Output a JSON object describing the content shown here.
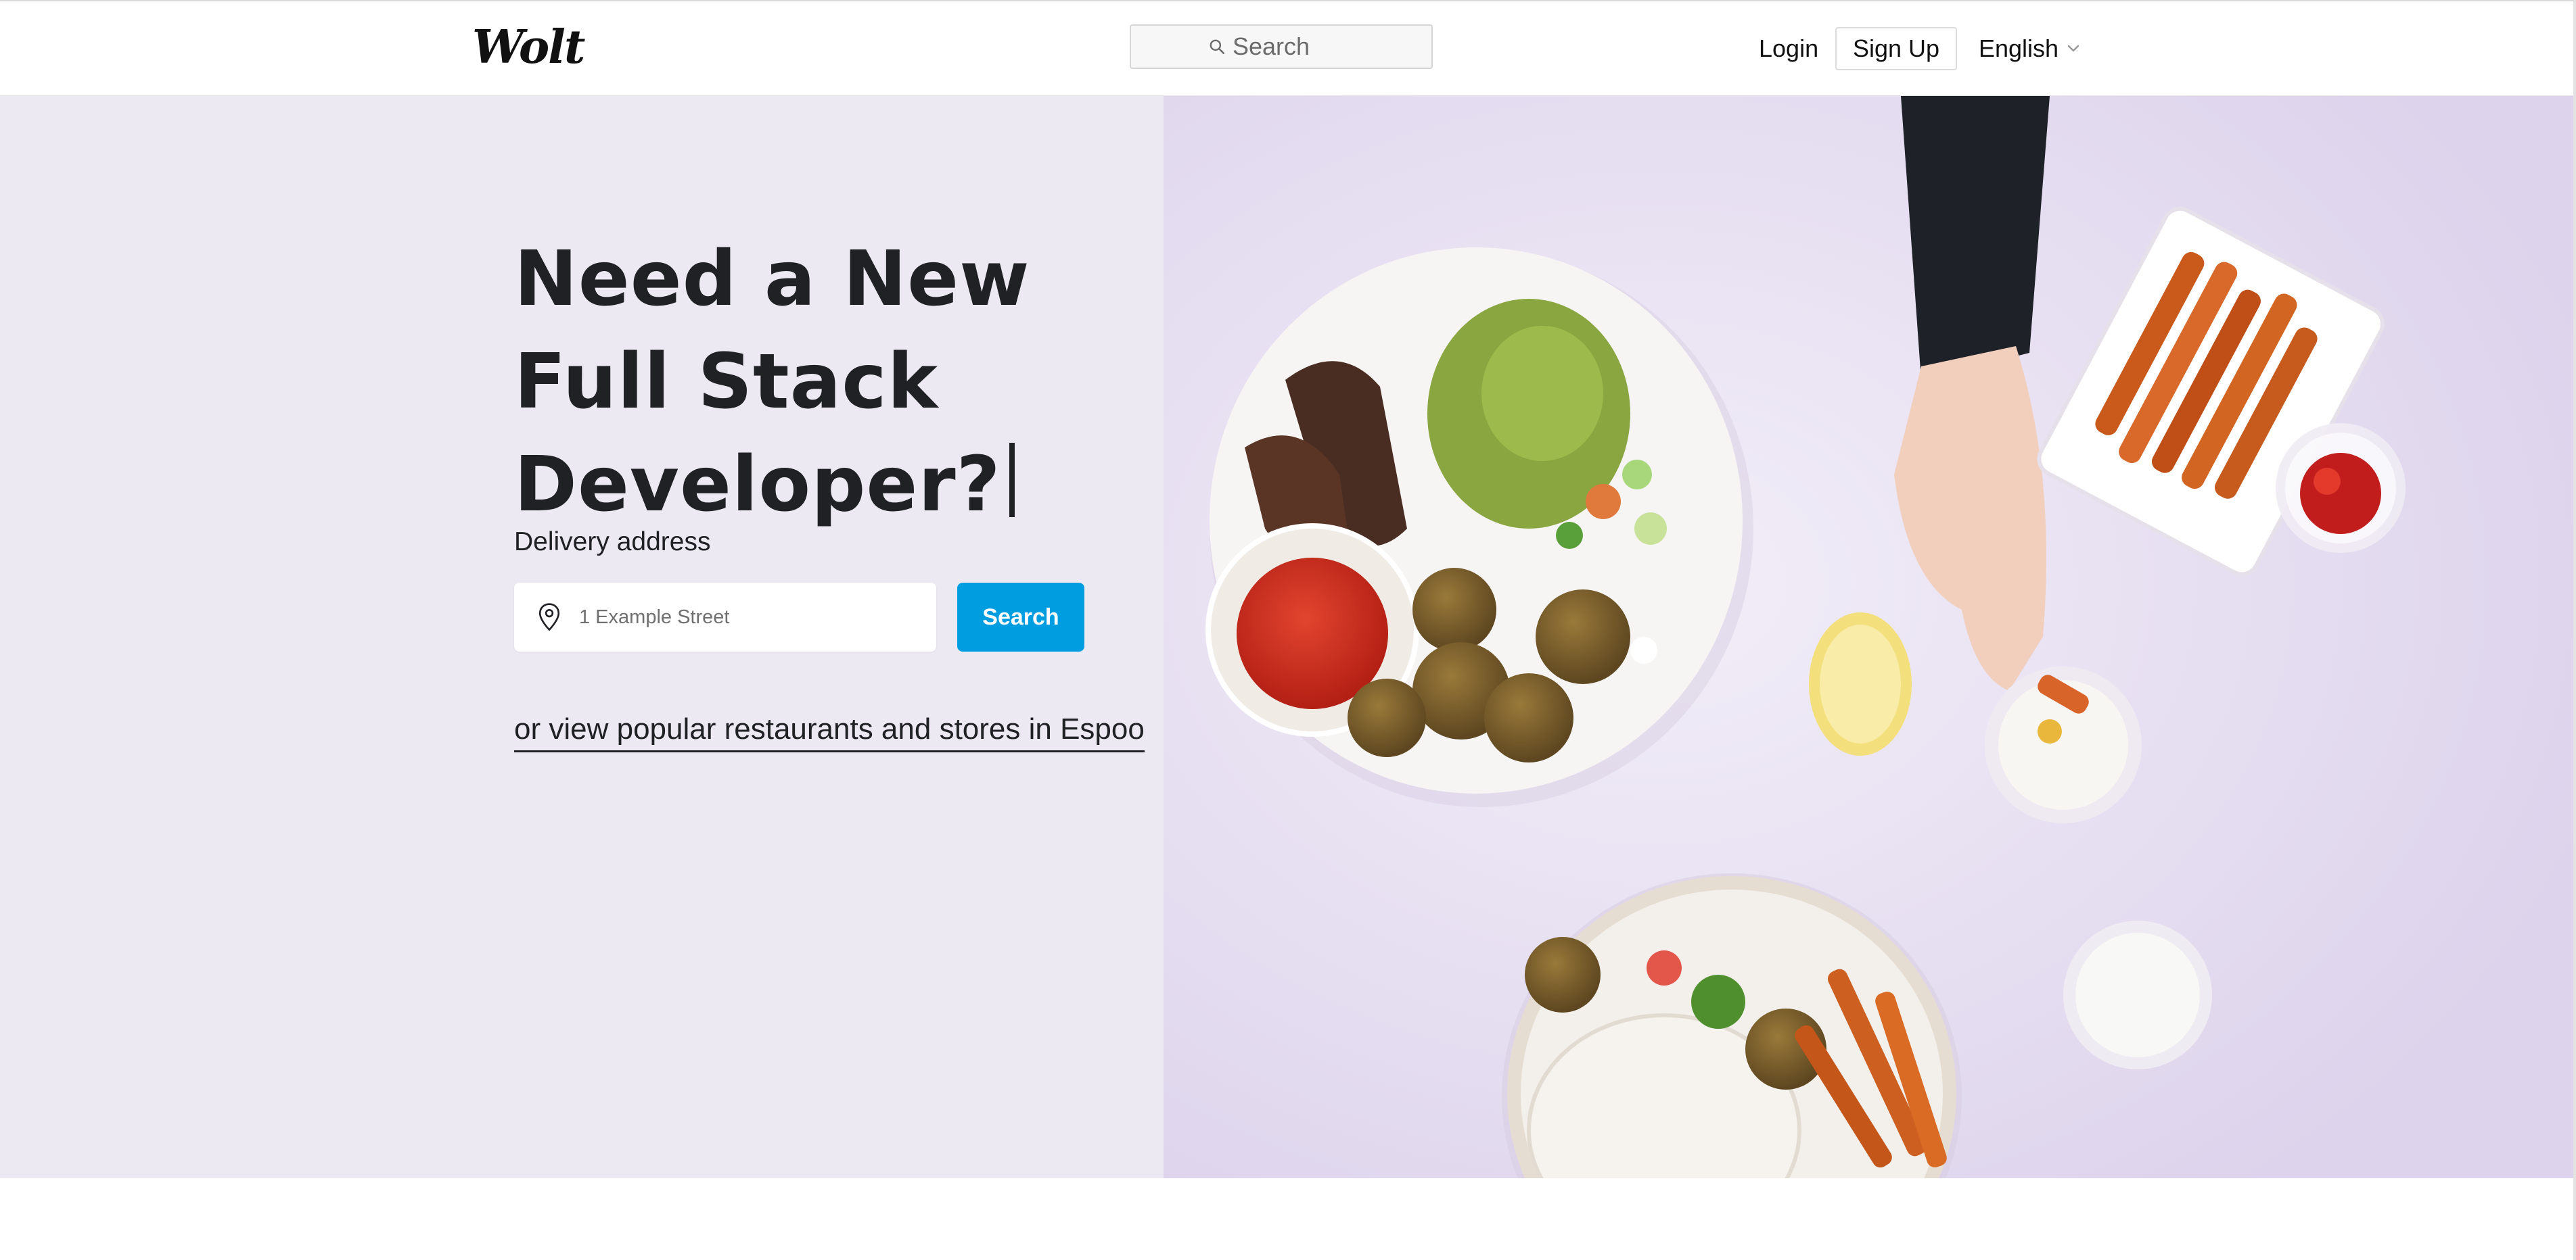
{
  "header": {
    "logo": "Wolt",
    "search_placeholder": "Search",
    "login_label": "Login",
    "signup_label": "Sign Up",
    "language_label": "English"
  },
  "hero": {
    "headline_lines": [
      "Need a New",
      "Full Stack",
      "Developer?"
    ],
    "delivery_label": "Delivery address",
    "address_placeholder": "1 Example Street",
    "search_button": "Search",
    "popular_link": "or view popular restaurants and stores in Espoo"
  },
  "colors": {
    "hero_background": "#ece9f2",
    "accent_button": "#009de0",
    "text_dark": "#202125"
  },
  "icons": {
    "search": "magnifier-icon",
    "language_dropdown": "chevron-down-icon",
    "address": "location-pin-icon"
  }
}
